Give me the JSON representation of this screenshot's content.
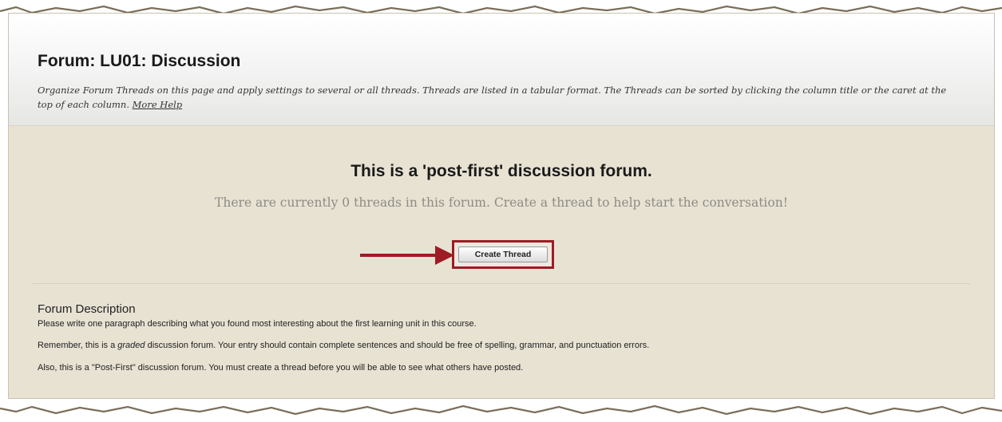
{
  "page": {
    "title": "Forum: LU01: Discussion",
    "intro_text": "Organize Forum Threads on this page and apply settings to several or all threads. Threads are listed in a tabular format. The Threads can be sorted by clicking the column title or the caret at the top of each column.",
    "more_help_label": "More Help"
  },
  "notice": {
    "title": "This is a 'post-first' discussion forum.",
    "message": "There are currently 0 threads in this forum. Create a thread to help start the conversation!"
  },
  "actions": {
    "create_thread_label": "Create Thread"
  },
  "description": {
    "heading": "Forum Description",
    "paragraphs": [
      {
        "before": "Please write one paragraph describing what you found most interesting about the first learning unit in this course.",
        "emphasis": "",
        "after": ""
      },
      {
        "before": "Remember, this is a ",
        "emphasis": "graded",
        "after": " discussion forum. Your entry should contain complete sentences and should be free of spelling, grammar, and punctuation errors."
      },
      {
        "before": "Also, this is a \"Post-First\" discussion forum. You must create a thread before you will be able to see what others have posted.",
        "emphasis": "",
        "after": ""
      }
    ]
  },
  "colors": {
    "panel_bg": "#e8e2d3",
    "highlight": "#9e1b25",
    "muted_text": "#8e8b84"
  }
}
